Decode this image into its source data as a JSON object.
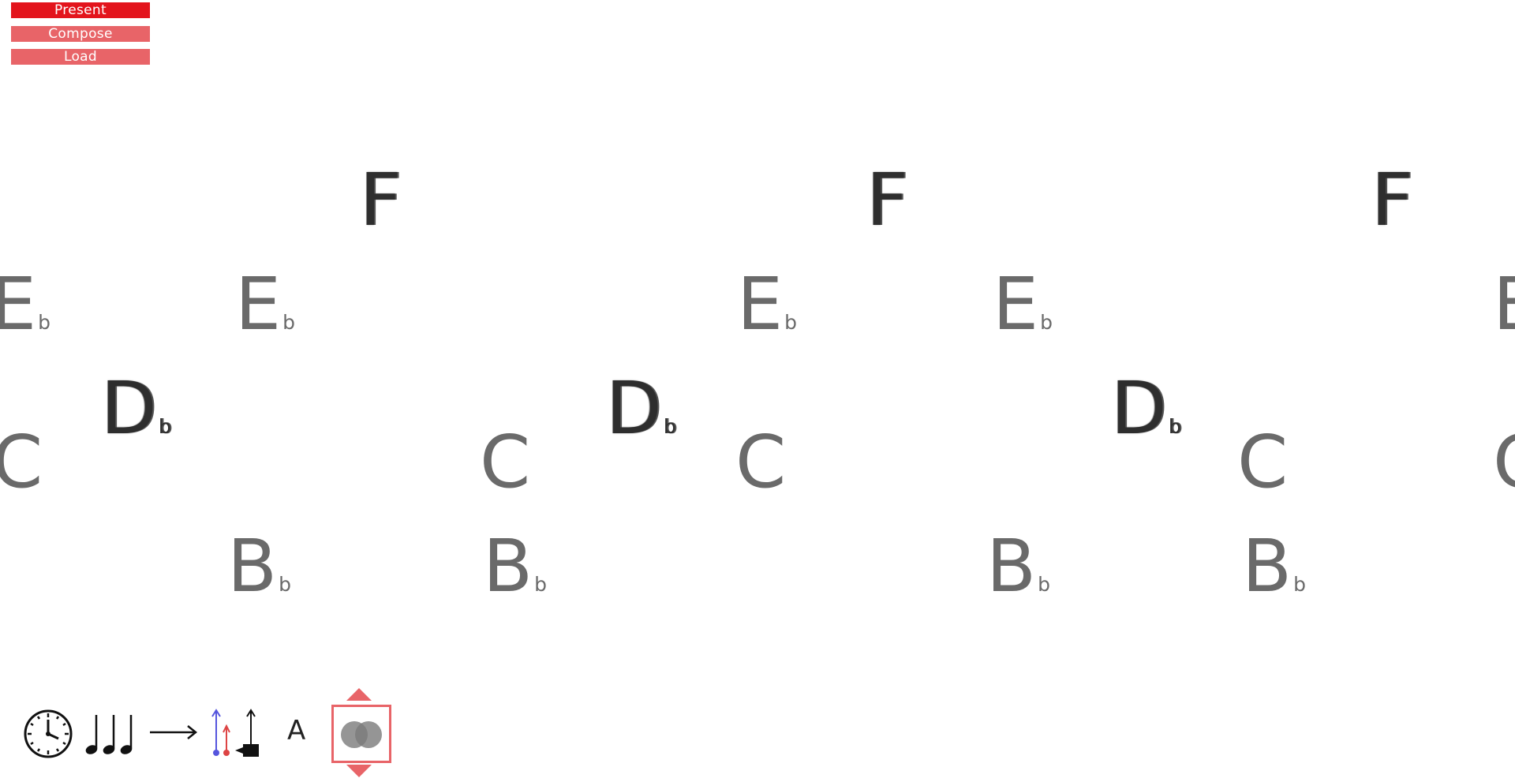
{
  "toolbar": {
    "present_label": "Present",
    "compose_label": "Compose",
    "load_label": "Load"
  },
  "notes": [
    {
      "letter": "E",
      "accidental": "b",
      "tone": "light"
    },
    {
      "letter": "C",
      "accidental": "",
      "tone": "light"
    },
    {
      "letter": "D",
      "accidental": "b",
      "tone": "dark"
    },
    {
      "letter": "B",
      "accidental": "b",
      "tone": "light"
    },
    {
      "letter": "E",
      "accidental": "b",
      "tone": "light"
    },
    {
      "letter": "F",
      "accidental": "",
      "tone": "dark"
    },
    {
      "letter": "C",
      "accidental": "",
      "tone": "light"
    },
    {
      "letter": "B",
      "accidental": "b",
      "tone": "light"
    },
    {
      "letter": "D",
      "accidental": "b",
      "tone": "dark"
    },
    {
      "letter": "E",
      "accidental": "b",
      "tone": "light"
    },
    {
      "letter": "C",
      "accidental": "",
      "tone": "light"
    },
    {
      "letter": "F",
      "accidental": "",
      "tone": "dark"
    },
    {
      "letter": "E",
      "accidental": "b",
      "tone": "light"
    },
    {
      "letter": "B",
      "accidental": "b",
      "tone": "light"
    },
    {
      "letter": "D",
      "accidental": "b",
      "tone": "dark"
    },
    {
      "letter": "C",
      "accidental": "",
      "tone": "light"
    },
    {
      "letter": "B",
      "accidental": "b",
      "tone": "light"
    },
    {
      "letter": "F",
      "accidental": "",
      "tone": "dark"
    },
    {
      "letter": "E",
      "accidental": "",
      "tone": "light"
    },
    {
      "letter": "C",
      "accidental": "",
      "tone": "light"
    }
  ],
  "bottom_tools": {
    "tempo_icon": "clock-icon",
    "rhythm_icon": "quarter-notes-icon",
    "arrow_icon": "right-arrow-icon",
    "voice_icon": "voice-lines-icon",
    "label_text": "A",
    "blend_icon": "overlap-circles-icon"
  },
  "colors": {
    "accent_active": "#e3141c",
    "accent": "#e86468",
    "note_light": "#6a6a6a",
    "note_dark": "#2e2e2e"
  }
}
